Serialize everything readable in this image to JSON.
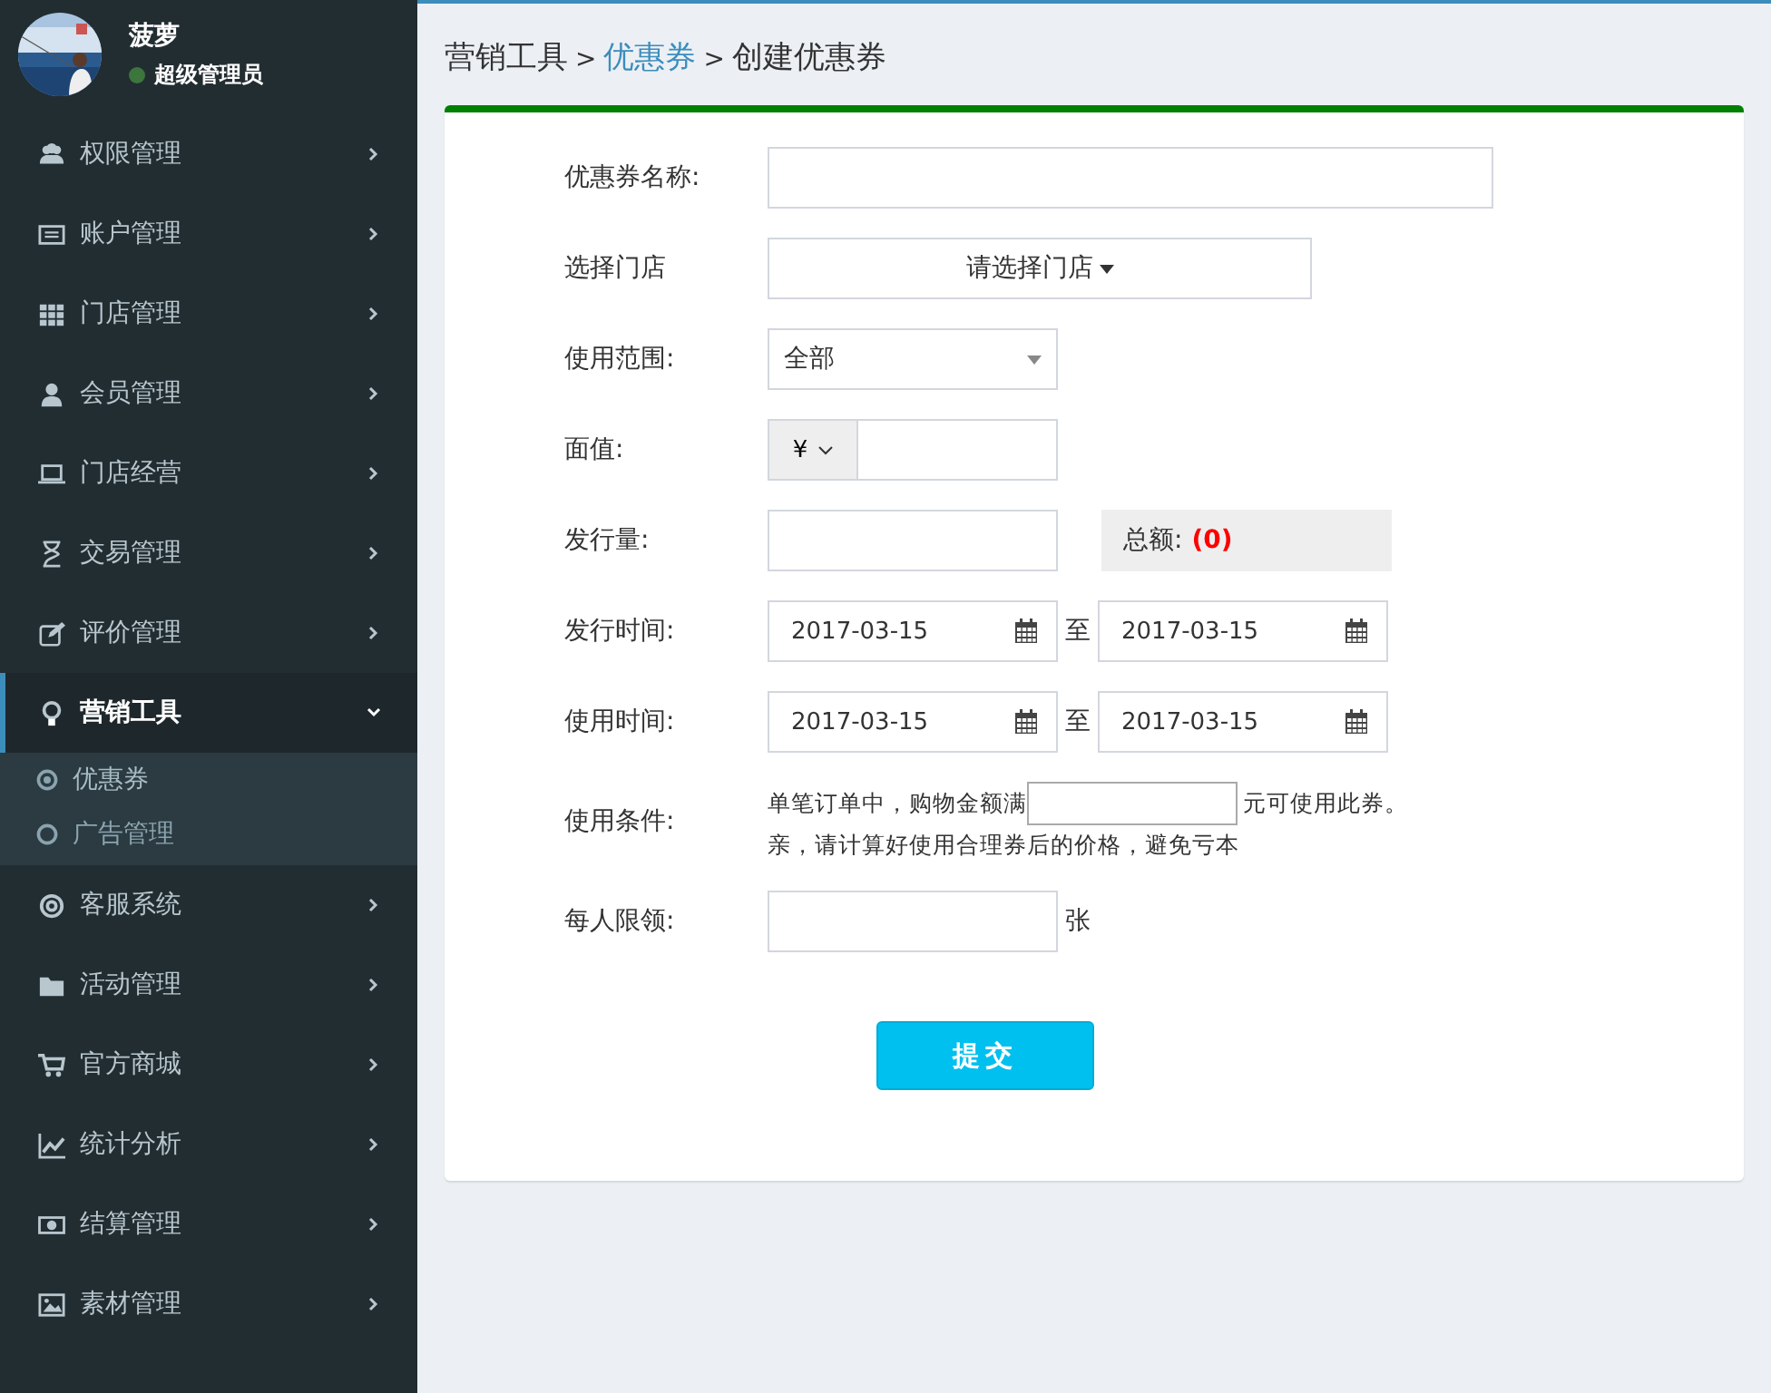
{
  "user": {
    "name": "菠萝",
    "role": "超级管理员",
    "online": true
  },
  "menu": [
    {
      "label": "权限管理",
      "expanded": false,
      "selected": false
    },
    {
      "label": "账户管理",
      "expanded": false,
      "selected": false
    },
    {
      "label": "门店管理",
      "expanded": false,
      "selected": false
    },
    {
      "label": "会员管理",
      "expanded": false,
      "selected": false
    },
    {
      "label": "门店经营",
      "expanded": false,
      "selected": false
    },
    {
      "label": "交易管理",
      "expanded": false,
      "selected": false
    },
    {
      "label": "评价管理",
      "expanded": false,
      "selected": false
    },
    {
      "label": "营销工具",
      "expanded": true,
      "selected": true,
      "children": [
        {
          "label": "优惠券",
          "selected": true
        },
        {
          "label": "广告管理",
          "selected": false
        }
      ]
    },
    {
      "label": "客服系统",
      "expanded": false,
      "selected": false
    },
    {
      "label": "活动管理",
      "expanded": false,
      "selected": false
    },
    {
      "label": "官方商城",
      "expanded": false,
      "selected": false
    },
    {
      "label": "统计分析",
      "expanded": false,
      "selected": false
    },
    {
      "label": "结算管理",
      "expanded": false,
      "selected": false
    },
    {
      "label": "素材管理",
      "expanded": false,
      "selected": false
    }
  ],
  "breadcrumb": [
    {
      "kind": "text",
      "label": "营销工具"
    },
    {
      "kind": "sep",
      "label": ">"
    },
    {
      "kind": "link",
      "label": "优惠券"
    },
    {
      "kind": "sep",
      "label": ">"
    },
    {
      "kind": "text",
      "label": "创建优惠券"
    }
  ],
  "form": {
    "fields": [
      {
        "kind": "text",
        "label": "优惠券名称:"
      },
      {
        "kind": "store",
        "label": "选择门店",
        "button": "请选择门店"
      },
      {
        "kind": "select",
        "label": "使用范围:",
        "value": "全部"
      },
      {
        "kind": "currency",
        "label": "面值:",
        "currency": "¥"
      },
      {
        "kind": "quantity",
        "label": "发行量:",
        "total_label": "总额:",
        "total": "(0)"
      },
      {
        "kind": "daterange",
        "label": "发行时间:",
        "start": "2017-03-15",
        "to": "至",
        "end": "2017-03-15"
      },
      {
        "kind": "daterange",
        "label": "使用时间:",
        "start": "2017-03-15",
        "to": "至",
        "end": "2017-03-15"
      },
      {
        "kind": "condition",
        "label": "使用条件:",
        "before": "单笔订单中，购物金额满",
        "after": "元可使用此券。",
        "hint": "亲，请计算好使用合理券后的价格，避免亏本"
      },
      {
        "kind": "limit",
        "label": "每人限领:",
        "unit": "张"
      }
    ],
    "submit": "提交"
  }
}
